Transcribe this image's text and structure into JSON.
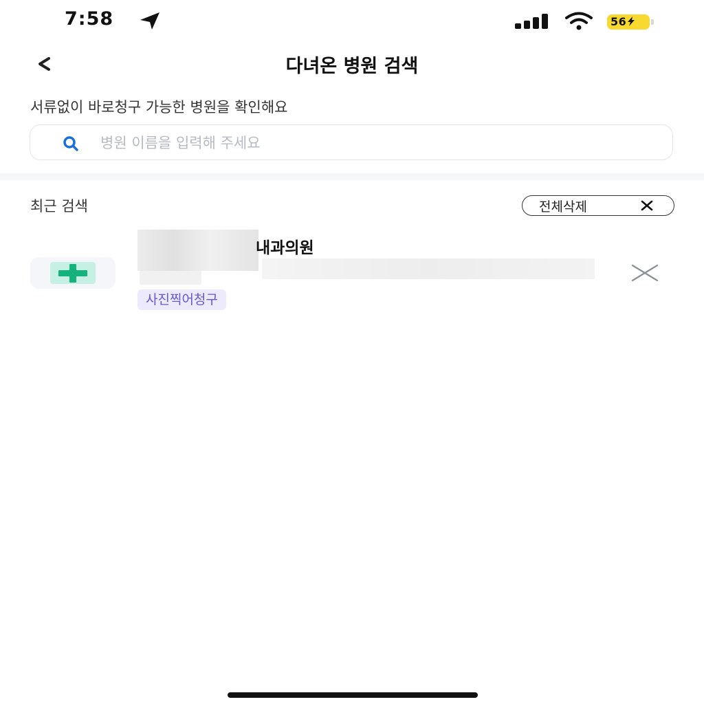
{
  "status_bar": {
    "time": "7:58",
    "battery_level": "56",
    "battery_color": "#f7d92f",
    "icons": [
      "location-arrow-icon",
      "cellular-signal-icon",
      "wifi-icon",
      "battery-charging-icon"
    ]
  },
  "nav": {
    "back_icon": "chevron-left-icon",
    "title": "다녀온 병원 검색"
  },
  "intro": {
    "subtitle": "서류없이 바로청구 가능한 병원을 확인해요"
  },
  "search": {
    "icon": "search-icon",
    "value": "",
    "placeholder": "병원 이름을 입력해 주세요"
  },
  "recent": {
    "title": "최근 검색",
    "clear_all_label": "전체삭제",
    "items": [
      {
        "name": "내과의원",
        "badge": "사진찍어청구",
        "logo_icon": "hospital-cross-icon",
        "remove_icon": "close-icon"
      }
    ]
  },
  "colors": {
    "accent": "#1b6fd8",
    "badge_bg": "#eceafc",
    "badge_text": "#6359d4",
    "hospital_cross": "#14b37d"
  }
}
